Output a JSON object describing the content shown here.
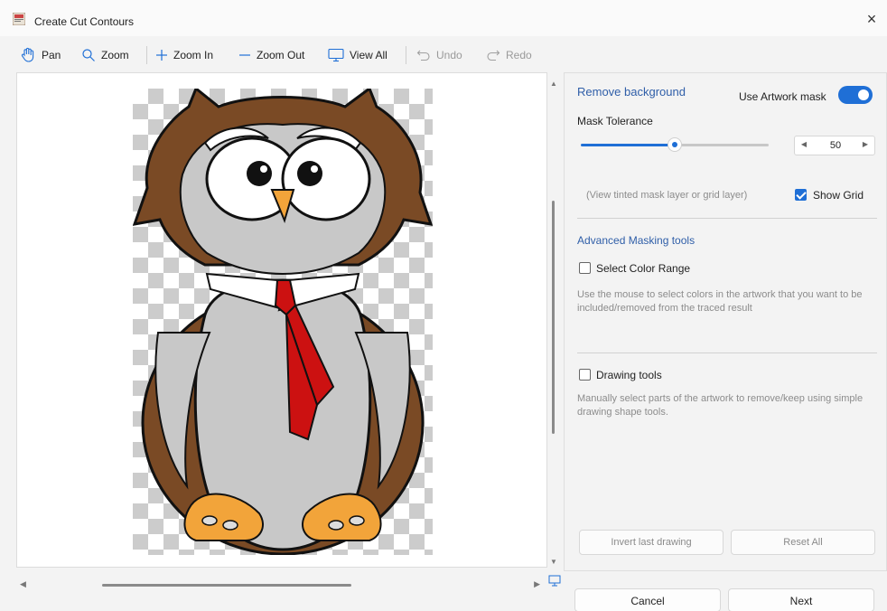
{
  "window": {
    "title": "Create Cut Contours",
    "close_label": "×"
  },
  "toolbar": {
    "pan": "Pan",
    "zoom": "Zoom",
    "zoom_in": "Zoom In",
    "zoom_out": "Zoom Out",
    "view_all": "View All",
    "undo": "Undo",
    "redo": "Redo"
  },
  "panel": {
    "remove_background": "Remove background",
    "use_artwork_mask": "Use Artwork mask",
    "use_artwork_mask_on": true,
    "mask_tolerance_label": "Mask Tolerance",
    "mask_tolerance_value": "50",
    "mask_tolerance_fraction": 0.5,
    "view_hint": "(View tinted mask layer or grid layer)",
    "show_grid": "Show Grid",
    "show_grid_checked": true,
    "advanced_heading": "Advanced Masking tools",
    "select_color_range": "Select Color Range",
    "select_color_range_checked": false,
    "select_color_help": "Use the mouse to select colors in the artwork that you want to be included/removed from the traced result",
    "drawing_tools": "Drawing tools",
    "drawing_tools_checked": false,
    "drawing_help": "Manually select parts of the artwork to remove/keep using simple drawing shape tools.",
    "invert_last_drawing": "Invert last drawing",
    "reset_all": "Reset All"
  },
  "footer": {
    "cancel": "Cancel",
    "next": "Next"
  },
  "colors": {
    "accent": "#1f6fd6",
    "heading": "#2f5ea8",
    "owl_brown": "#7a4a25",
    "owl_gray": "#c8c8c8",
    "tie_red": "#cc1111",
    "feet_orange": "#f2a43a"
  }
}
